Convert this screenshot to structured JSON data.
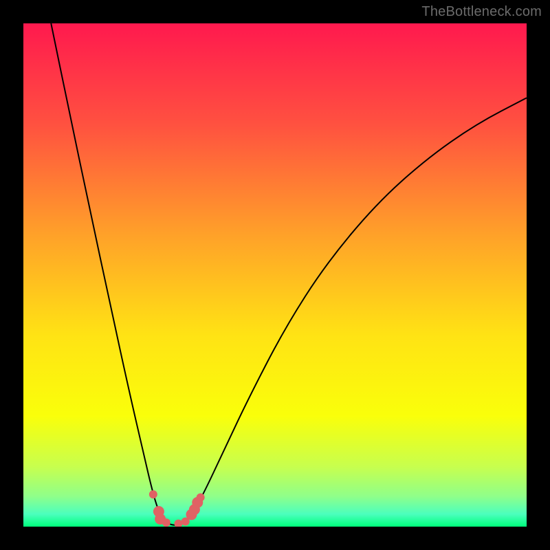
{
  "attribution": "TheBottleneck.com",
  "chart_data": {
    "type": "line",
    "title": "",
    "xlabel": "",
    "ylabel": "",
    "xlim": [
      0,
      1
    ],
    "ylim": [
      0,
      1
    ],
    "background_gradient": {
      "stops": [
        {
          "offset": 0.0,
          "color": "#ff194e"
        },
        {
          "offset": 0.2,
          "color": "#ff5140"
        },
        {
          "offset": 0.42,
          "color": "#ffa129"
        },
        {
          "offset": 0.62,
          "color": "#ffe314"
        },
        {
          "offset": 0.78,
          "color": "#faff0a"
        },
        {
          "offset": 0.88,
          "color": "#c8ff4d"
        },
        {
          "offset": 0.94,
          "color": "#8fff8a"
        },
        {
          "offset": 0.975,
          "color": "#4bffbd"
        },
        {
          "offset": 1.0,
          "color": "#00ff7c"
        }
      ]
    },
    "series": [
      {
        "name": "bottleneck-curve",
        "type": "line",
        "points": [
          {
            "x": 0.055,
            "y": 1.0
          },
          {
            "x": 0.09,
            "y": 0.83
          },
          {
            "x": 0.13,
            "y": 0.64
          },
          {
            "x": 0.175,
            "y": 0.43
          },
          {
            "x": 0.21,
            "y": 0.27
          },
          {
            "x": 0.24,
            "y": 0.14
          },
          {
            "x": 0.256,
            "y": 0.072
          },
          {
            "x": 0.268,
            "y": 0.032
          },
          {
            "x": 0.28,
            "y": 0.01
          },
          {
            "x": 0.295,
            "y": 0.003
          },
          {
            "x": 0.31,
            "y": 0.003
          },
          {
            "x": 0.326,
            "y": 0.014
          },
          {
            "x": 0.342,
            "y": 0.036
          },
          {
            "x": 0.365,
            "y": 0.08
          },
          {
            "x": 0.4,
            "y": 0.155
          },
          {
            "x": 0.45,
            "y": 0.26
          },
          {
            "x": 0.52,
            "y": 0.395
          },
          {
            "x": 0.6,
            "y": 0.52
          },
          {
            "x": 0.7,
            "y": 0.64
          },
          {
            "x": 0.8,
            "y": 0.73
          },
          {
            "x": 0.9,
            "y": 0.8
          },
          {
            "x": 1.0,
            "y": 0.852
          }
        ]
      },
      {
        "name": "highlight-markers",
        "type": "scatter",
        "points": [
          {
            "x": 0.258,
            "y": 0.064,
            "r": 6
          },
          {
            "x": 0.269,
            "y": 0.03,
            "r": 8
          },
          {
            "x": 0.272,
            "y": 0.015,
            "r": 8
          },
          {
            "x": 0.284,
            "y": 0.008,
            "r": 6
          },
          {
            "x": 0.308,
            "y": 0.006,
            "r": 6
          },
          {
            "x": 0.322,
            "y": 0.01,
            "r": 6
          },
          {
            "x": 0.334,
            "y": 0.024,
            "r": 8
          },
          {
            "x": 0.34,
            "y": 0.034,
            "r": 8
          },
          {
            "x": 0.346,
            "y": 0.048,
            "r": 8
          },
          {
            "x": 0.352,
            "y": 0.058,
            "r": 6
          }
        ]
      }
    ]
  }
}
